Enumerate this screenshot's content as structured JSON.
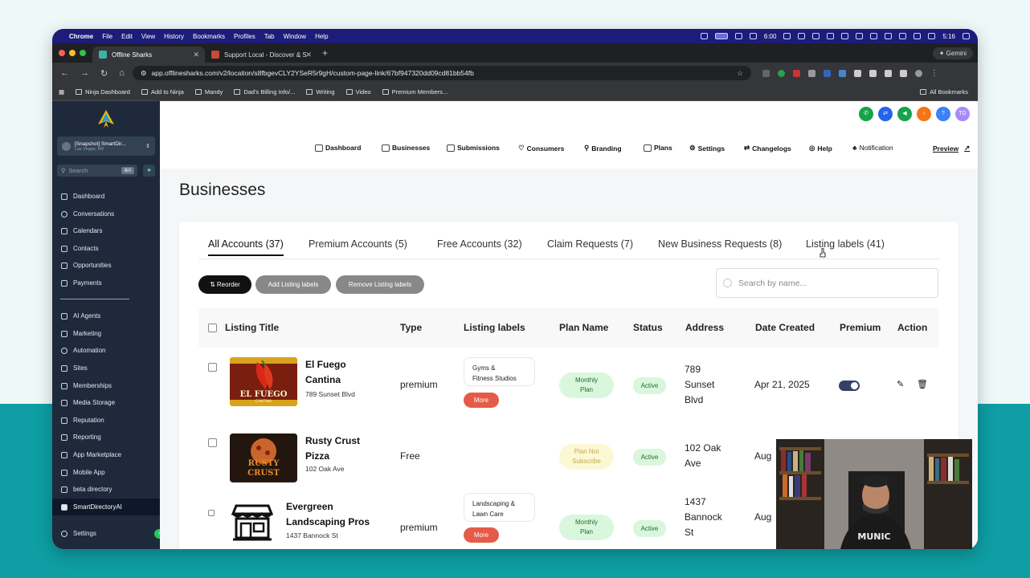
{
  "menubar": {
    "items": [
      "Chrome",
      "File",
      "Edit",
      "View",
      "History",
      "Bookmarks",
      "Profiles",
      "Tab",
      "Window",
      "Help"
    ],
    "time": "5:16",
    "battery_time": "6:00"
  },
  "tabs": [
    {
      "title": "Offline Sharks",
      "active": true
    },
    {
      "title": "Support Local - Discover & S",
      "active": false
    }
  ],
  "gemini_label": "Gemini",
  "url": "app.offlinesharks.com/v2/location/s8fbgevCLY2YSeR5r9gH/custom-page-link/67bf947320dd09cd81bb54fb",
  "bookmarks": [
    "Ninja Dashboard",
    "Add to Ninja",
    "Mandy",
    "Dad's Billing Info/...",
    "Writing",
    "Video",
    "Premium Members..."
  ],
  "all_bookmarks": "All Bookmarks",
  "sidebar": {
    "account_name": "[Snapshot] SmartDir...",
    "account_location": "Las Vegas, NV",
    "search_placeholder": "Search",
    "search_kbd": "⌘K",
    "items_top": [
      "Dashboard",
      "Conversations",
      "Calendars",
      "Contacts",
      "Opportunities",
      "Payments"
    ],
    "items_bottom": [
      "AI Agents",
      "Marketing",
      "Automation",
      "Sites",
      "Memberships",
      "Media Storage",
      "Reputation",
      "Reporting",
      "App Marketplace",
      "Mobile App",
      "beta directory",
      "SmartDirectoryAI"
    ],
    "settings": "Settings"
  },
  "topbar": {
    "avatar_initials": "TG",
    "help_icon": "?"
  },
  "topnav": [
    "Dashboard",
    "Businesses",
    "Submissions",
    "Consumers",
    "Branding",
    "Plans",
    "Settings",
    "Changelogs",
    "Help",
    "Notification",
    "Preview"
  ],
  "page_title": "Businesses",
  "content_tabs": [
    "All Accounts (37)",
    "Premium Accounts (5)",
    "Free Accounts (32)",
    "Claim Requests (7)",
    "New Business Requests (8)",
    "Listing labels (41)"
  ],
  "actions": {
    "reorder": "Reorder",
    "add": "Add Listing labels",
    "remove": "Remove Listing labels"
  },
  "search_placeholder": "Search by name...",
  "columns": [
    "Listing Title",
    "Type",
    "Listing labels",
    "Plan Name",
    "Status",
    "Address",
    "Date Created",
    "Premium",
    "Action"
  ],
  "rows": [
    {
      "name_l1": "El Fuego",
      "name_l2": "Cantina",
      "addr": "789 Sunset Blvd",
      "type": "premium",
      "label_l1": "Gyms &",
      "label_l2": "Fitness Studios",
      "more": "More",
      "plan_l1": "Monthly",
      "plan_l2": "Plan",
      "status": "Active",
      "a1": "789",
      "a2": "Sunset",
      "a3": "Blvd",
      "date": "Apr 21, 2025",
      "thumb_text": "EL FUEGO",
      "thumb_sub": "CANTINA"
    },
    {
      "name_l1": "Rusty Crust",
      "name_l2": "Pizza",
      "addr": "102 Oak Ave",
      "type": "Free",
      "plan_l1": "Plan Not",
      "plan_l2": "Subscribe",
      "status": "Active",
      "a1": "102 Oak",
      "a2": "Ave",
      "date": "Aug",
      "thumb_text": "RUSTY",
      "thumb_sub": "CRUST"
    },
    {
      "name_l1": "Evergreen",
      "name_l2": "Landscaping Pros",
      "addr": "1437 Bannock St",
      "type": "premium",
      "label_l1": "Landscaping &",
      "label_l2": "Lawn Care",
      "more": "More",
      "plan_l1": "Monthly",
      "plan_l2": "Plan",
      "status": "Active",
      "a1": "1437",
      "a2": "Bannock",
      "a3": "St",
      "date": "Aug"
    }
  ],
  "webcam_text": "MUNIC"
}
